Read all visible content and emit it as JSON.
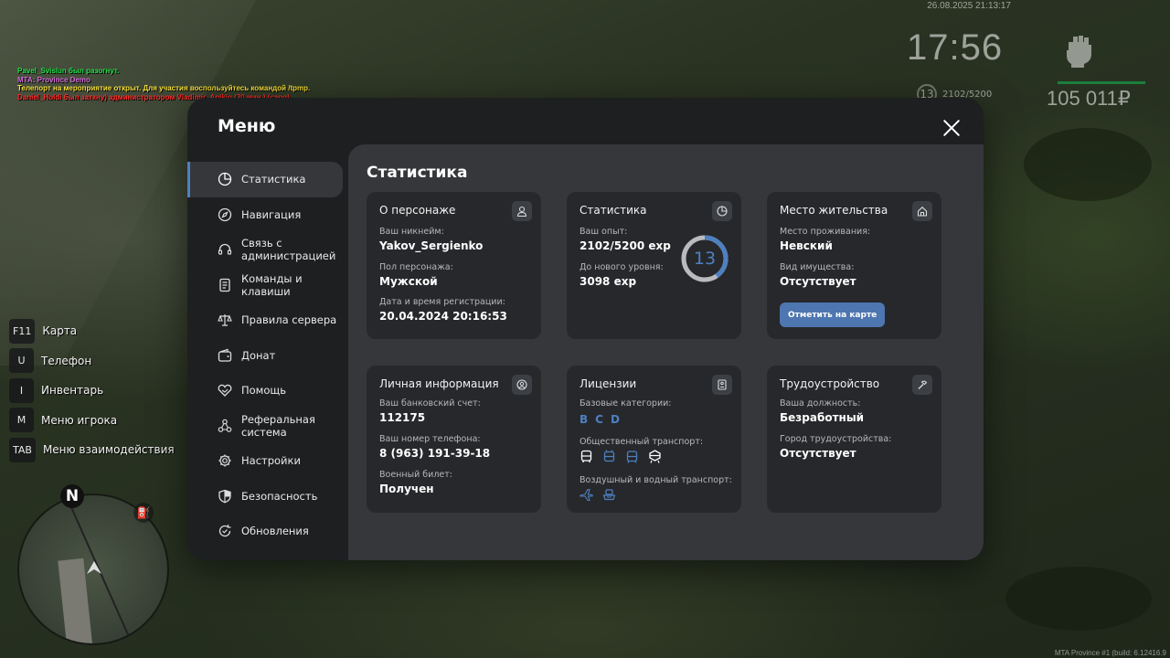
{
  "chat": [
    {
      "text": "Pavel_Svislun был разогнут.",
      "color": "#22e04a"
    },
    {
      "text": "MTA: Province Demo",
      "color": "#d46bd8"
    },
    {
      "text": "Телепорт на мероприятие открыт. Для участия воспользуйтесь командой /tpmp.",
      "color": "#f5e03a"
    },
    {
      "text": "Daniel_Holdi был заткну) администратором Vladimir_Anikin (30 мин.) (capo)",
      "color": "#ff2a2a"
    }
  ],
  "hud": {
    "datetime": "26.08.2025 21:13:17",
    "clock": "17:56",
    "level": "13",
    "exp": "2102/5200",
    "money": "105 011₽",
    "weapon_icon": "fist-icon"
  },
  "hotkeys": [
    {
      "key": "F11",
      "label": "Карта"
    },
    {
      "key": "U",
      "label": "Телефон"
    },
    {
      "key": "I",
      "label": "Инвентарь"
    },
    {
      "key": "M",
      "label": "Меню игрока"
    },
    {
      "key": "TAB",
      "label": "Меню взаимодействия"
    }
  ],
  "minimap": {
    "north": "N",
    "fuel_icon": "fuel-pump-icon"
  },
  "build": "MTA Province #1 (build: 6.12416.9",
  "menu": {
    "title": "Меню",
    "nav": [
      {
        "label": "Статистика",
        "icon": "stats-icon",
        "active": true
      },
      {
        "label": "Навигация",
        "icon": "compass-icon",
        "active": false
      },
      {
        "label": "Связь с администрацией",
        "icon": "headset-icon",
        "active": false
      },
      {
        "label": "Команды и клавиши",
        "icon": "document-icon",
        "active": false
      },
      {
        "label": "Правила сервера",
        "icon": "scales-icon",
        "active": false
      },
      {
        "label": "Донат",
        "icon": "wallet-icon",
        "active": false
      },
      {
        "label": "Помощь",
        "icon": "handshake-icon",
        "active": false
      },
      {
        "label": "Реферальная система",
        "icon": "network-icon",
        "active": false
      },
      {
        "label": "Настройки",
        "icon": "gear-icon",
        "active": false
      },
      {
        "label": "Безопасность",
        "icon": "shield-icon",
        "active": false
      },
      {
        "label": "Обновления",
        "icon": "update-icon",
        "active": false
      }
    ],
    "content_title": "Статистика",
    "cards": {
      "character": {
        "title": "О персонаже",
        "nickname_label": "Ваш никнейм:",
        "nickname": "Yakov_Sergienko",
        "gender_label": "Пол персонажа:",
        "gender": "Мужской",
        "reg_label": "Дата и время регистрации:",
        "reg": "20.04.2024 20:16:53"
      },
      "stats": {
        "title": "Статистика",
        "exp_label": "Ваш опыт:",
        "exp": "2102/5200 exp",
        "next_label": "До нового уровня:",
        "next": "3098 exp",
        "level": "13",
        "progress": 0.404
      },
      "residence": {
        "title": "Место жительства",
        "place_label": "Место проживания:",
        "place": "Невский",
        "property_label": "Вид имущества:",
        "property": "Отсутствует",
        "button": "Отметить на карте"
      },
      "personal": {
        "title": "Личная информация",
        "bank_label": "Ваш банковский счет:",
        "bank": "112175",
        "phone_label": "Ваш номер телефона:",
        "phone": "8 (963) 191-39-18",
        "military_label": "Военный билет:",
        "military": "Получен"
      },
      "licenses": {
        "title": "Лицензии",
        "base_label": "Базовые категории:",
        "base": [
          "B",
          "C",
          "D"
        ],
        "public_label": "Общественный транспорт:",
        "public_icons": [
          "bus-icon",
          "trolleybus-icon",
          "tram-icon",
          "train-icon"
        ],
        "air_label": "Воздушный и водный транспорт:",
        "air_icons": [
          "plane-icon",
          "boat-icon"
        ]
      },
      "job": {
        "title": "Трудоустройство",
        "position_label": "Ваша должность:",
        "position": "Безработный",
        "city_label": "Город трудоустройства:",
        "city": "Отсутствует"
      }
    }
  },
  "colors": {
    "accent": "#4e80c2",
    "panel": "#1e1f21",
    "content": "#35373b",
    "card": "#26282b"
  }
}
